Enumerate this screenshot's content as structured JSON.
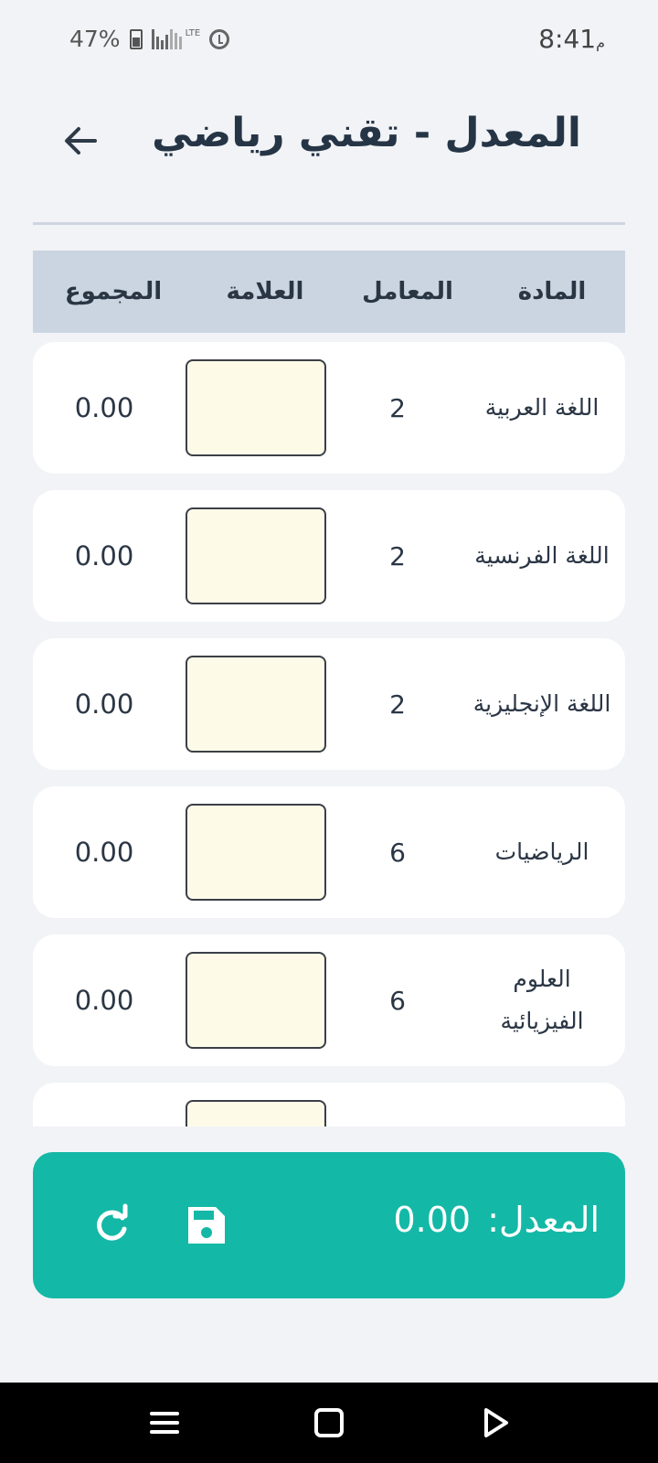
{
  "status_bar": {
    "time": "8:41",
    "ampm": "م",
    "battery_percent": "47%",
    "network": "LTE"
  },
  "header": {
    "title": "المعدل - تقني رياضي"
  },
  "table": {
    "columns": {
      "subject": "المادة",
      "coefficient": "المعامل",
      "grade": "العلامة",
      "total": "المجموع"
    },
    "rows": [
      {
        "subject": "اللغة العربية",
        "coefficient": "2",
        "grade": "",
        "total": "0.00"
      },
      {
        "subject": "اللغة الفرنسية",
        "coefficient": "2",
        "grade": "",
        "total": "0.00"
      },
      {
        "subject": "اللغة الإنجليزية",
        "coefficient": "2",
        "grade": "",
        "total": "0.00"
      },
      {
        "subject": "الرياضيات",
        "coefficient": "6",
        "grade": "",
        "total": "0.00"
      },
      {
        "subject": "العلوم الفيزيائية",
        "coefficient": "6",
        "grade": "",
        "total": "0.00"
      },
      {
        "subject": "",
        "coefficient": "",
        "grade": "",
        "total": ""
      }
    ]
  },
  "footer": {
    "average_label": "المعدل:",
    "average_value": "0.00",
    "refresh_icon": "refresh-icon",
    "save_icon": "save-icon"
  },
  "colors": {
    "accent": "#14b8a6",
    "header_bg": "#cbd5e1",
    "grade_field": "#fdfbe8"
  }
}
